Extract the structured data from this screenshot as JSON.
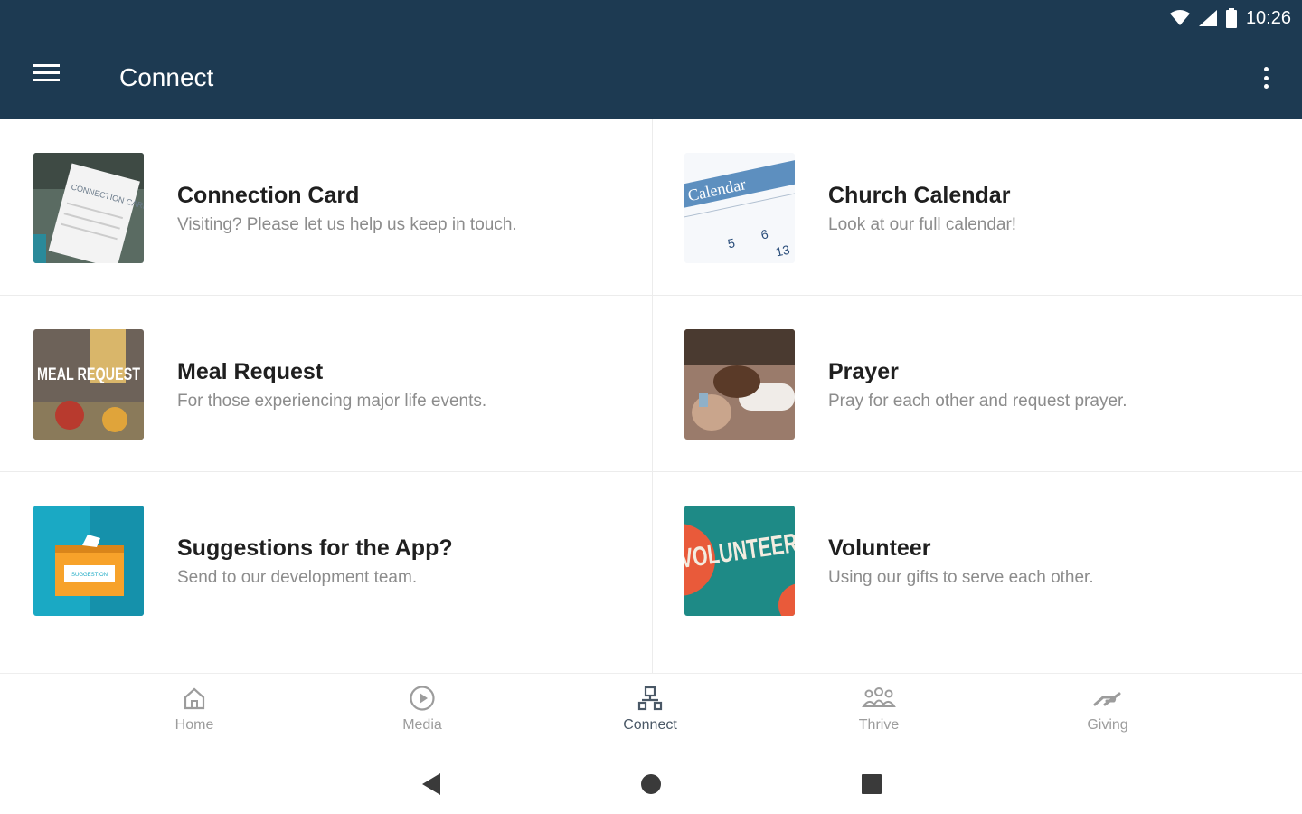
{
  "status_bar": {
    "time": "10:26"
  },
  "app_bar": {
    "title": "Connect",
    "menu_icon": "hamburger-menu-icon",
    "overflow_icon": "more-vert-icon"
  },
  "items": [
    {
      "title": "Connection Card",
      "subtitle": "Visiting? Please let us help us keep in touch.",
      "thumb_text": "CONNECTION CARD"
    },
    {
      "title": "Church Calendar",
      "subtitle": "Look at our full calendar!",
      "thumb_text": "Calendar"
    },
    {
      "title": "Meal Request",
      "subtitle": "For those experiencing major life events.",
      "thumb_text": "MEAL REQUEST"
    },
    {
      "title": "Prayer",
      "subtitle": "Pray for each other and request prayer."
    },
    {
      "title": "Suggestions for the App?",
      "subtitle": "Send to our development team.",
      "thumb_text": "SUGGESTION"
    },
    {
      "title": "Volunteer",
      "subtitle": "Using our gifts to serve each other.",
      "thumb_text": "VOLUNTEERS NEEDED"
    }
  ],
  "bottom_nav": [
    {
      "label": "Home",
      "icon": "home-icon"
    },
    {
      "label": "Media",
      "icon": "play-circle-icon"
    },
    {
      "label": "Connect",
      "icon": "connect-icon",
      "active": true
    },
    {
      "label": "Thrive",
      "icon": "people-icon"
    },
    {
      "label": "Giving",
      "icon": "giving-hand-icon"
    }
  ],
  "colors": {
    "app_bar": "#1d3a52",
    "active_tab": "#4a5866",
    "inactive_tab": "#9c9c9c"
  }
}
